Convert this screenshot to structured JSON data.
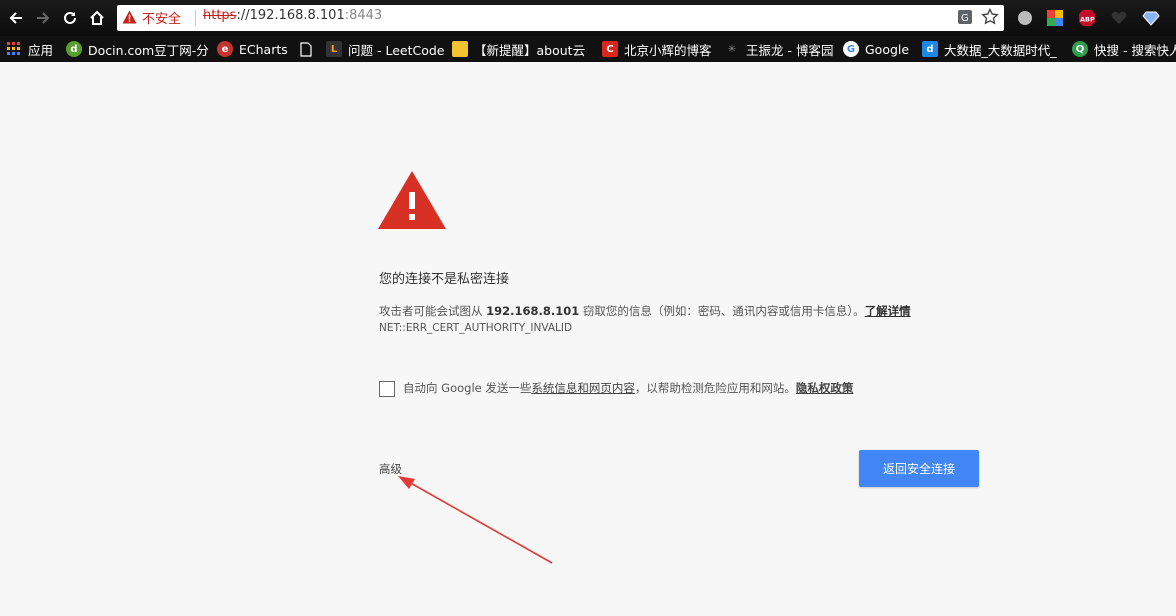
{
  "browser": {
    "security_status": "不安全",
    "url_scheme": "https",
    "url_host": "://192.168.8.101",
    "url_port": ":8443",
    "bookmarks": [
      {
        "label": "应用",
        "icon": "apps-grid-icon"
      },
      {
        "label": "Docin.com豆丁网-分",
        "icon": "docin-icon"
      },
      {
        "label": "ECharts",
        "icon": "echarts-icon"
      },
      {
        "label": "",
        "icon": "page-icon"
      },
      {
        "label": "问题 - LeetCode",
        "icon": "leetcode-icon"
      },
      {
        "label": "【新提醒】about云",
        "icon": "about-cloud-icon"
      },
      {
        "label": "北京小辉的博客",
        "icon": "csdn-icon"
      },
      {
        "label": "王振龙 - 博客园",
        "icon": "cnblogs-icon"
      },
      {
        "label": "Google",
        "icon": "google-icon"
      },
      {
        "label": "大数据_大数据时代_",
        "icon": "bigdata-icon"
      },
      {
        "label": "快搜 - 搜索快人",
        "icon": "kuaisou-icon"
      }
    ],
    "extensions": [
      "circle-extension-icon",
      "colorful-extension-icon",
      "abp-icon",
      "heart-extension-icon",
      "diamond-extension-icon"
    ],
    "abp_label": "ABP"
  },
  "page": {
    "heading": "您的连接不是私密连接",
    "desc_prefix": "攻击者可能会试图从 ",
    "desc_host": "192.168.8.101",
    "desc_suffix": " 窃取您的信息（例如：密码、通讯内容或信用卡信息）。",
    "learn_more": "了解详情",
    "error_code": "NET::ERR_CERT_AUTHORITY_INVALID",
    "checkbox_prefix": "自动向 Google 发送一些",
    "checkbox_link": "系统信息和网页内容",
    "checkbox_middle": "，以帮助检测危险应用和网站。",
    "privacy_link": "隐私权政策",
    "advanced_label": "高级",
    "back_button": "返回安全连接"
  },
  "colors": {
    "warning_red": "#d93025",
    "primary_blue": "#4285f4"
  }
}
